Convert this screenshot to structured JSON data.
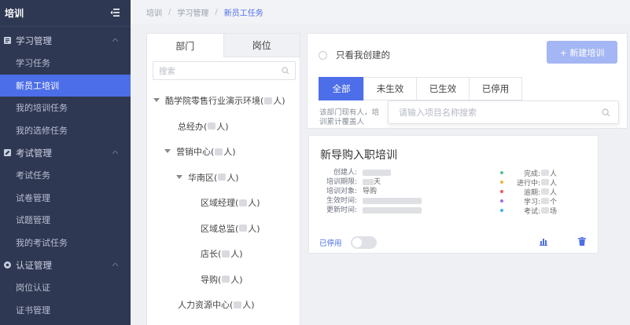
{
  "sidebar": {
    "title": "培训",
    "groups": [
      {
        "label": "学习管理",
        "items": [
          "学习任务",
          "新员工培训",
          "我的培训任务",
          "我的选修任务"
        ]
      },
      {
        "label": "考试管理",
        "items": [
          "考试任务",
          "试卷管理",
          "试题管理",
          "我的考试任务"
        ]
      },
      {
        "label": "认证管理",
        "items": [
          "岗位认证",
          "证书管理"
        ]
      }
    ],
    "active_item": "新员工培训",
    "accent": "#4c6ee8",
    "bg": "#2f3852"
  },
  "breadcrumb": [
    "培训",
    "学习管理",
    "新员工任务"
  ],
  "left_panel": {
    "tabs": [
      "部门",
      "岗位"
    ],
    "search_placeholder": "搜索",
    "tree": [
      {
        "label": "酷学院零售行业演示环境(",
        "suffix": "人)",
        "level": 0,
        "expanded": true
      },
      {
        "label": "总经办(",
        "suffix": "人)",
        "level": 1,
        "expanded": false
      },
      {
        "label": "营销中心(",
        "suffix": "人)",
        "level": 1,
        "expanded": true
      },
      {
        "label": "华南区(",
        "suffix": "人)",
        "level": 2,
        "expanded": true
      },
      {
        "label": "区域经理(",
        "suffix": "人)",
        "level": 3,
        "expanded": false
      },
      {
        "label": "区域总监(",
        "suffix": "人)",
        "level": 3,
        "expanded": false
      },
      {
        "label": "店长(",
        "suffix": "人)",
        "level": 3,
        "expanded": false
      },
      {
        "label": "导购(",
        "suffix": "人)",
        "level": 3,
        "expanded": false
      },
      {
        "label": "人力资源中心(",
        "suffix": "人)",
        "level": 1,
        "expanded": false
      }
    ]
  },
  "toolbar": {
    "only_mine_label": "只看我创建的",
    "new_button": "+ 新建培训",
    "status_tabs": [
      "全部",
      "未生效",
      "已生效",
      "已停用"
    ],
    "hint_line1": "该部门现有人，培",
    "hint_line2": "训累计覆盖人",
    "search_placeholder": "请输入项目名称搜索"
  },
  "card": {
    "title": "新导购入职培训",
    "info": [
      {
        "key": "创建人:",
        "value": ""
      },
      {
        "key": "培训期限:",
        "value": "天"
      },
      {
        "key": "培训对象:",
        "value": "导购"
      },
      {
        "key": "生效时间:",
        "value": ""
      },
      {
        "key": "更新时间:",
        "value": ""
      }
    ],
    "stats": [
      {
        "key": "完成:",
        "value": "人",
        "color": "#5bc08a"
      },
      {
        "key": "进行中:",
        "value": "人",
        "color": "#f0b43c"
      },
      {
        "key": "逾期:",
        "value": "人",
        "color": "#e85a5a"
      },
      {
        "key": "学习:",
        "value": "个",
        "color": "#a06ce0"
      },
      {
        "key": "考试:",
        "value": "场",
        "color": "#3fb4e8"
      }
    ],
    "status_label": "已停用",
    "toggle_on": false
  }
}
